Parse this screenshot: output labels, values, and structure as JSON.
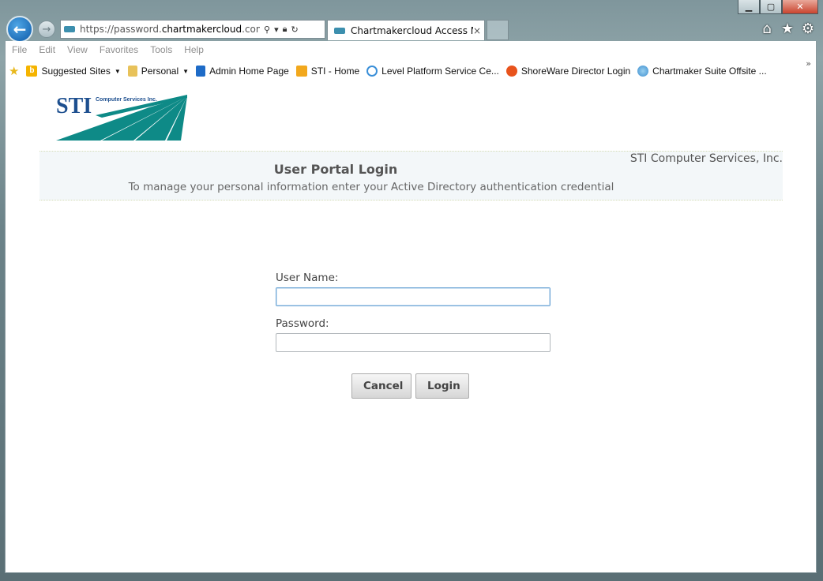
{
  "browser": {
    "address": {
      "prefix": "https://password.",
      "domain": "chartmakercloud",
      "suffix": ".com/user"
    },
    "tab": {
      "label": "Chartmakercloud Access M...",
      "close": "×"
    },
    "window_buttons": [
      "minimize-icon",
      "maximize-icon",
      "close-icon"
    ],
    "toolbar_icons": [
      "home-icon",
      "favorites-star-icon",
      "gear-icon"
    ]
  },
  "menu": [
    "File",
    "Edit",
    "View",
    "Favorites",
    "Tools",
    "Help"
  ],
  "favorites": [
    {
      "label": "Suggested Sites",
      "icon": "bing-icon",
      "color": "#f5b400",
      "dropdown": true
    },
    {
      "label": "Personal",
      "icon": "folder-icon",
      "color": "#e8c25a",
      "dropdown": true
    },
    {
      "label": "Admin Home Page",
      "icon": "office-icon",
      "color": "#1e6bc7"
    },
    {
      "label": "STI - Home",
      "icon": "sti-icon",
      "color": "#f2a81d"
    },
    {
      "label": "Level Platform Service Ce...",
      "icon": "ie-icon",
      "color": "#3a8fd8"
    },
    {
      "label": "ShoreWare Director Login",
      "icon": "shoretel-icon",
      "color": "#e8531c"
    },
    {
      "label": "Chartmaker Suite Offsite ...",
      "icon": "globe-icon",
      "color": "#3e8fd0"
    }
  ],
  "page": {
    "logo_text": "STI",
    "logo_subtext": "Computer Services Inc.",
    "company": "STI Computer Services, Inc.",
    "title": "User Portal Login",
    "subtitle": "To manage your personal information enter your Active Directory authentication credential",
    "username_label": "User Name:",
    "username_value": "",
    "password_label": "Password:",
    "password_value": "",
    "cancel_label": "Cancel",
    "login_label": "Login"
  },
  "colors": {
    "accent": "#0e8a87",
    "logo_blue": "#1d4f8f",
    "back_button": "#1b74c2"
  }
}
